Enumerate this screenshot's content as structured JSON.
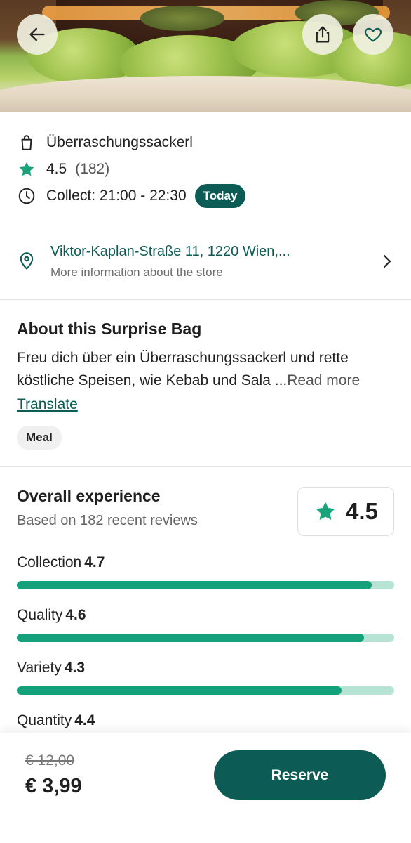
{
  "header": {
    "back_icon": "arrow-left-icon",
    "share_icon": "share-icon",
    "favorite_icon": "heart-icon"
  },
  "store": {
    "bag_name": "Überraschungssackerl",
    "rating": "4.5",
    "rating_count": "(182)",
    "collect": "Collect: 21:00 - 22:30",
    "day_badge": "Today"
  },
  "address": {
    "street": "Viktor-Kaplan-Straße 11, 1220 Wien,...",
    "more_info": "More information about the store"
  },
  "about": {
    "title": "About this Surprise Bag",
    "description": "Freu dich über ein Überraschungssackerl und rette köstliche Speisen, wie Kebab und Sala ...",
    "read_more": "Read more",
    "translate": "Translate",
    "category_chip": "Meal"
  },
  "reviews": {
    "title": "Overall experience",
    "based_on": "Based on 182 recent reviews",
    "overall_score": "4.5",
    "metrics": [
      {
        "label": "Collection",
        "score": "4.7",
        "value": 4.7,
        "max": 5
      },
      {
        "label": "Quality",
        "score": "4.6",
        "value": 4.6,
        "max": 5
      },
      {
        "label": "Variety",
        "score": "4.3",
        "value": 4.3,
        "max": 5
      },
      {
        "label": "Quantity",
        "score": "4.4",
        "value": 4.4,
        "max": 5
      }
    ]
  },
  "checkout": {
    "original_price": "€ 12,00",
    "price": "€ 3,99",
    "reserve_label": "Reserve"
  },
  "colors": {
    "brand_dark": "#0c5c55",
    "bar_fill": "#14a07a",
    "bar_track": "#b6e3d3",
    "star": "#1aa37a"
  }
}
